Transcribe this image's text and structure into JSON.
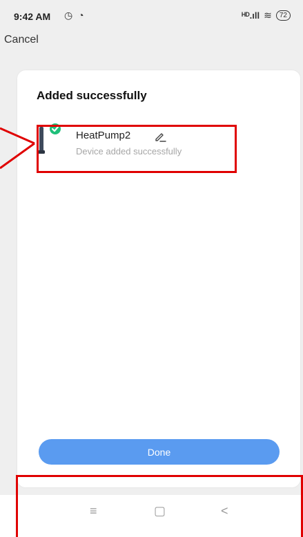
{
  "status_bar": {
    "time": "9:42 AM",
    "left_icons": "◷ ◔",
    "signal": "ᴴᴰ.ıll",
    "wifi": "≋",
    "battery": "72"
  },
  "header": {
    "cancel_label": "Cancel"
  },
  "card": {
    "title": "Added successfully",
    "device": {
      "name": "HeatPump2",
      "status": "Device added successfully",
      "icon": "device-check-icon"
    },
    "done_label": "Done"
  },
  "nav": {
    "menu_glyph": "≡",
    "home_glyph": "▢",
    "back_glyph": "<"
  },
  "colors": {
    "accent": "#5a9bf0",
    "check": "#1fbf7a",
    "annotation": "#e00000"
  }
}
